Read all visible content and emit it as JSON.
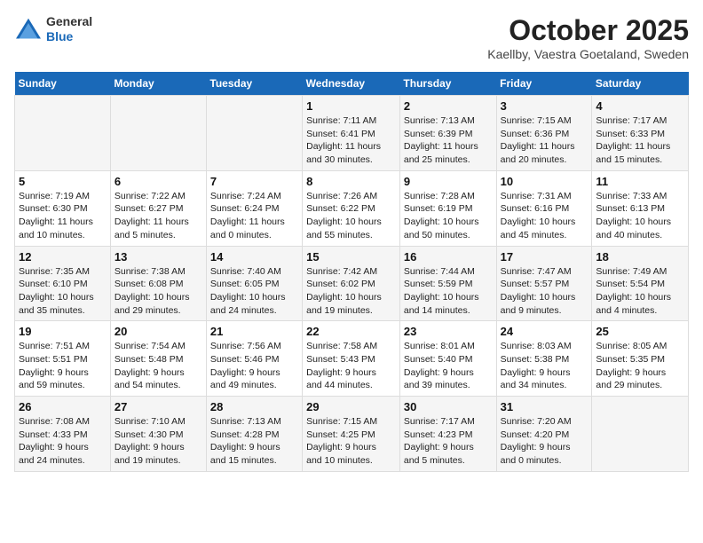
{
  "header": {
    "logo": {
      "general": "General",
      "blue": "Blue"
    },
    "title": "October 2025",
    "location": "Kaellby, Vaestra Goetaland, Sweden"
  },
  "weekdays": [
    "Sunday",
    "Monday",
    "Tuesday",
    "Wednesday",
    "Thursday",
    "Friday",
    "Saturday"
  ],
  "weeks": [
    [
      {
        "day": "",
        "info": ""
      },
      {
        "day": "",
        "info": ""
      },
      {
        "day": "",
        "info": ""
      },
      {
        "day": "1",
        "info": "Sunrise: 7:11 AM\nSunset: 6:41 PM\nDaylight: 11 hours\nand 30 minutes."
      },
      {
        "day": "2",
        "info": "Sunrise: 7:13 AM\nSunset: 6:39 PM\nDaylight: 11 hours\nand 25 minutes."
      },
      {
        "day": "3",
        "info": "Sunrise: 7:15 AM\nSunset: 6:36 PM\nDaylight: 11 hours\nand 20 minutes."
      },
      {
        "day": "4",
        "info": "Sunrise: 7:17 AM\nSunset: 6:33 PM\nDaylight: 11 hours\nand 15 minutes."
      }
    ],
    [
      {
        "day": "5",
        "info": "Sunrise: 7:19 AM\nSunset: 6:30 PM\nDaylight: 11 hours\nand 10 minutes."
      },
      {
        "day": "6",
        "info": "Sunrise: 7:22 AM\nSunset: 6:27 PM\nDaylight: 11 hours\nand 5 minutes."
      },
      {
        "day": "7",
        "info": "Sunrise: 7:24 AM\nSunset: 6:24 PM\nDaylight: 11 hours\nand 0 minutes."
      },
      {
        "day": "8",
        "info": "Sunrise: 7:26 AM\nSunset: 6:22 PM\nDaylight: 10 hours\nand 55 minutes."
      },
      {
        "day": "9",
        "info": "Sunrise: 7:28 AM\nSunset: 6:19 PM\nDaylight: 10 hours\nand 50 minutes."
      },
      {
        "day": "10",
        "info": "Sunrise: 7:31 AM\nSunset: 6:16 PM\nDaylight: 10 hours\nand 45 minutes."
      },
      {
        "day": "11",
        "info": "Sunrise: 7:33 AM\nSunset: 6:13 PM\nDaylight: 10 hours\nand 40 minutes."
      }
    ],
    [
      {
        "day": "12",
        "info": "Sunrise: 7:35 AM\nSunset: 6:10 PM\nDaylight: 10 hours\nand 35 minutes."
      },
      {
        "day": "13",
        "info": "Sunrise: 7:38 AM\nSunset: 6:08 PM\nDaylight: 10 hours\nand 29 minutes."
      },
      {
        "day": "14",
        "info": "Sunrise: 7:40 AM\nSunset: 6:05 PM\nDaylight: 10 hours\nand 24 minutes."
      },
      {
        "day": "15",
        "info": "Sunrise: 7:42 AM\nSunset: 6:02 PM\nDaylight: 10 hours\nand 19 minutes."
      },
      {
        "day": "16",
        "info": "Sunrise: 7:44 AM\nSunset: 5:59 PM\nDaylight: 10 hours\nand 14 minutes."
      },
      {
        "day": "17",
        "info": "Sunrise: 7:47 AM\nSunset: 5:57 PM\nDaylight: 10 hours\nand 9 minutes."
      },
      {
        "day": "18",
        "info": "Sunrise: 7:49 AM\nSunset: 5:54 PM\nDaylight: 10 hours\nand 4 minutes."
      }
    ],
    [
      {
        "day": "19",
        "info": "Sunrise: 7:51 AM\nSunset: 5:51 PM\nDaylight: 9 hours\nand 59 minutes."
      },
      {
        "day": "20",
        "info": "Sunrise: 7:54 AM\nSunset: 5:48 PM\nDaylight: 9 hours\nand 54 minutes."
      },
      {
        "day": "21",
        "info": "Sunrise: 7:56 AM\nSunset: 5:46 PM\nDaylight: 9 hours\nand 49 minutes."
      },
      {
        "day": "22",
        "info": "Sunrise: 7:58 AM\nSunset: 5:43 PM\nDaylight: 9 hours\nand 44 minutes."
      },
      {
        "day": "23",
        "info": "Sunrise: 8:01 AM\nSunset: 5:40 PM\nDaylight: 9 hours\nand 39 minutes."
      },
      {
        "day": "24",
        "info": "Sunrise: 8:03 AM\nSunset: 5:38 PM\nDaylight: 9 hours\nand 34 minutes."
      },
      {
        "day": "25",
        "info": "Sunrise: 8:05 AM\nSunset: 5:35 PM\nDaylight: 9 hours\nand 29 minutes."
      }
    ],
    [
      {
        "day": "26",
        "info": "Sunrise: 7:08 AM\nSunset: 4:33 PM\nDaylight: 9 hours\nand 24 minutes."
      },
      {
        "day": "27",
        "info": "Sunrise: 7:10 AM\nSunset: 4:30 PM\nDaylight: 9 hours\nand 19 minutes."
      },
      {
        "day": "28",
        "info": "Sunrise: 7:13 AM\nSunset: 4:28 PM\nDaylight: 9 hours\nand 15 minutes."
      },
      {
        "day": "29",
        "info": "Sunrise: 7:15 AM\nSunset: 4:25 PM\nDaylight: 9 hours\nand 10 minutes."
      },
      {
        "day": "30",
        "info": "Sunrise: 7:17 AM\nSunset: 4:23 PM\nDaylight: 9 hours\nand 5 minutes."
      },
      {
        "day": "31",
        "info": "Sunrise: 7:20 AM\nSunset: 4:20 PM\nDaylight: 9 hours\nand 0 minutes."
      },
      {
        "day": "",
        "info": ""
      }
    ]
  ]
}
